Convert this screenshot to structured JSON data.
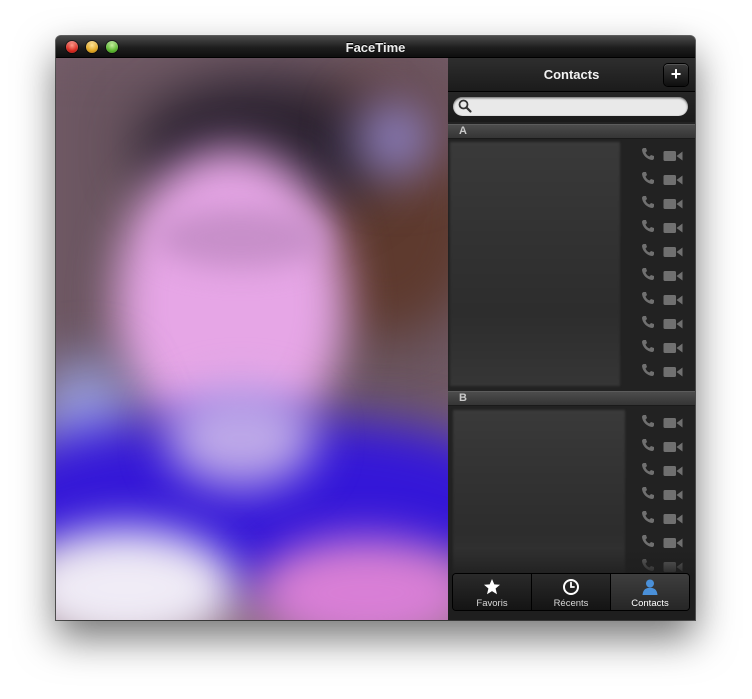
{
  "window": {
    "title": "FaceTime",
    "traffic_lights": [
      "close",
      "minimize",
      "zoom"
    ]
  },
  "contacts_panel": {
    "title": "Contacts",
    "add_label": "+",
    "search": {
      "value": "",
      "placeholder": ""
    },
    "sections": [
      {
        "letter": "A",
        "visible_rows": 10
      },
      {
        "letter": "B",
        "visible_rows": 7
      }
    ]
  },
  "tabs": [
    {
      "label": "Favoris",
      "icon": "star-icon",
      "active": false
    },
    {
      "label": "Récents",
      "icon": "clock-icon",
      "active": false
    },
    {
      "label": "Contacts",
      "icon": "person-icon",
      "active": true
    }
  ],
  "colors": {
    "accent_blue": "#4a90d9",
    "panel_bg": "#222222",
    "icon_gray": "#6f6f6f"
  }
}
